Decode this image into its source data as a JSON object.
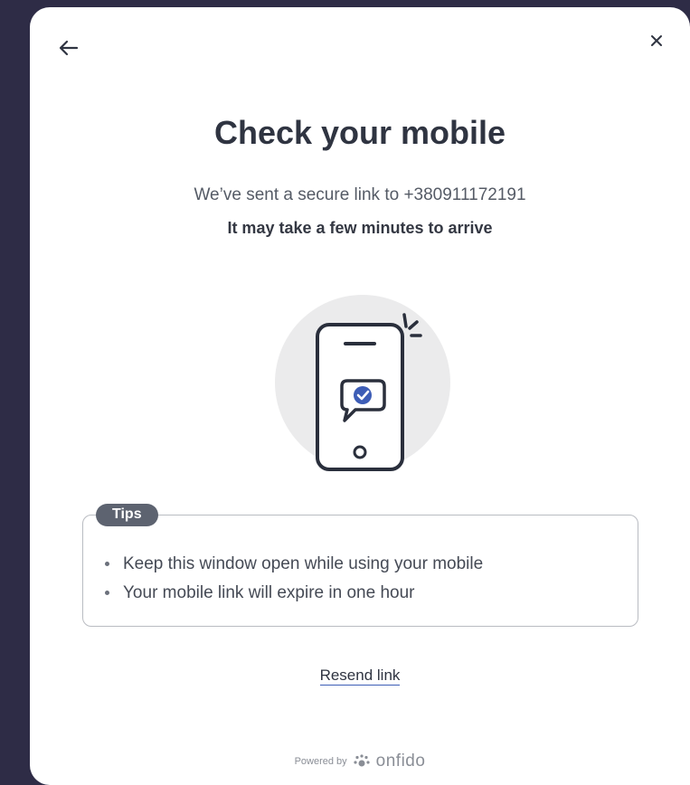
{
  "dialog": {
    "title": "Check your mobile",
    "subtitle": "We’ve sent a secure link to +380911172191",
    "subtitle_strong": "It may take a few minutes to arrive"
  },
  "icons": {
    "back": "arrow-left-icon",
    "close": "close-icon",
    "illustration": "phone-message-check-icon",
    "brand": "onfido-logo-icon"
  },
  "tips": {
    "label": "Tips",
    "items": [
      "Keep this window open while using your mobile",
      "Your mobile link will expire in one hour"
    ]
  },
  "actions": {
    "resend_label": "Resend link"
  },
  "footer": {
    "powered_by": "Powered by",
    "brand": "onfido"
  },
  "colors": {
    "background": "#2e2c46",
    "card": "#ffffff",
    "accent": "#3d5db6",
    "text_dark": "#2f3441",
    "badge": "#5d6370"
  }
}
